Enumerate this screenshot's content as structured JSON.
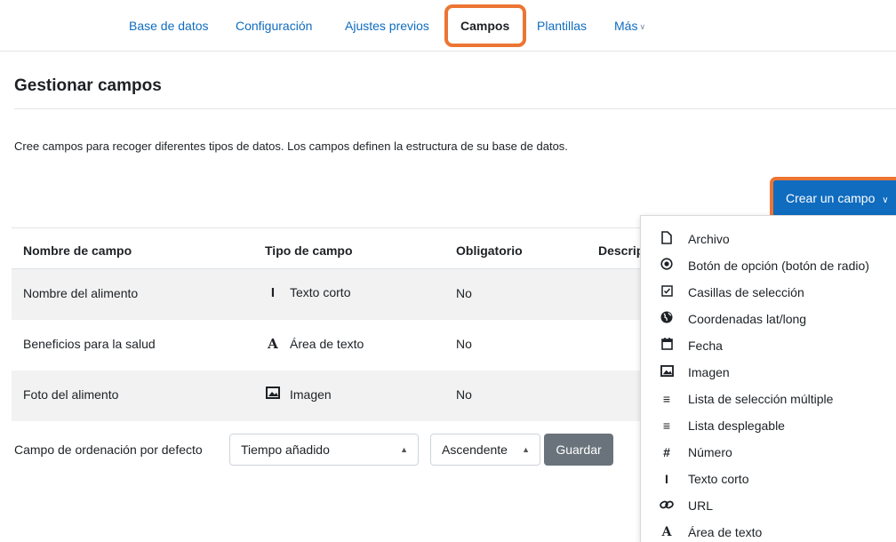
{
  "nav": {
    "items": [
      {
        "label": "Base de datos",
        "active": false
      },
      {
        "label": "Configuración",
        "active": false
      },
      {
        "label": "Ajustes previos",
        "active": false
      },
      {
        "label": "Campos",
        "active": true
      },
      {
        "label": "Plantillas",
        "active": false
      },
      {
        "label": "Más",
        "active": false
      }
    ]
  },
  "page": {
    "title": "Gestionar campos",
    "description": "Cree campos para recoger diferentes tipos de datos. Los campos definen la estructura de su base de datos."
  },
  "create_button": {
    "label": "Crear un campo"
  },
  "table": {
    "headers": [
      "Nombre de campo",
      "Tipo de campo",
      "Obligatorio",
      "Descrip"
    ],
    "rows": [
      {
        "name": "Nombre del alimento",
        "type": "Texto corto",
        "type_icon": "text-cursor-icon",
        "required": "No"
      },
      {
        "name": "Beneficios para la salud",
        "type": "Área de texto",
        "type_icon": "textarea-icon",
        "required": "No"
      },
      {
        "name": "Foto del alimento",
        "type": "Imagen",
        "type_icon": "image-icon",
        "required": "No"
      }
    ]
  },
  "sort": {
    "label": "Campo de ordenación por defecto",
    "field_value": "Tiempo añadido",
    "order_value": "Ascendente",
    "save_label": "Guardar"
  },
  "menu": {
    "items": [
      {
        "label": "Archivo",
        "icon": "file-icon"
      },
      {
        "label": "Botón de opción (botón de radio)",
        "icon": "radio-icon"
      },
      {
        "label": "Casillas de selección",
        "icon": "checkbox-icon"
      },
      {
        "label": "Coordenadas lat/long",
        "icon": "globe-icon"
      },
      {
        "label": "Fecha",
        "icon": "calendar-icon"
      },
      {
        "label": "Imagen",
        "icon": "image-icon"
      },
      {
        "label": "Lista de selección múltiple",
        "icon": "list-icon"
      },
      {
        "label": "Lista desplegable",
        "icon": "list-icon"
      },
      {
        "label": "Número",
        "icon": "hash-icon"
      },
      {
        "label": "Texto corto",
        "icon": "text-cursor-icon"
      },
      {
        "label": "URL",
        "icon": "link-icon"
      },
      {
        "label": "Área de texto",
        "icon": "textarea-icon"
      }
    ]
  },
  "colors": {
    "primary": "#0f6cbf",
    "highlight": "#ec7533",
    "secondary_button": "#6a737b"
  }
}
